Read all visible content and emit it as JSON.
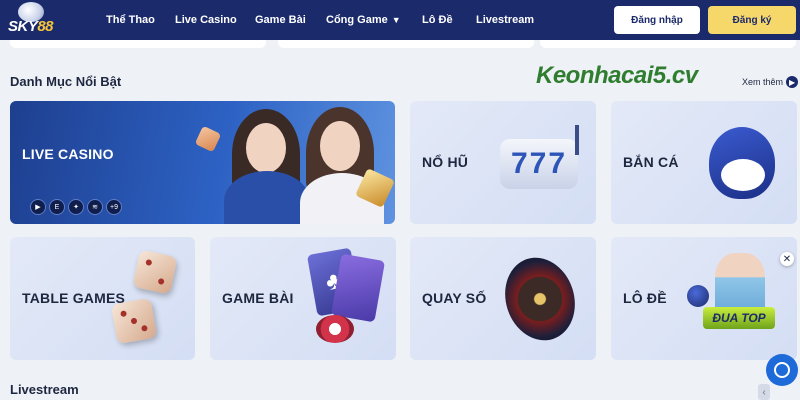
{
  "brand": {
    "logo_text_1": "SKY",
    "logo_text_2": "88"
  },
  "nav": {
    "items": [
      {
        "label": "Thể Thao"
      },
      {
        "label": "Live Casino"
      },
      {
        "label": "Game Bài"
      },
      {
        "label": "Cổng Game",
        "has_dropdown": true
      },
      {
        "label": "Lô Đề"
      },
      {
        "label": "Livestream"
      }
    ],
    "login_label": "Đăng nhập",
    "register_label": "Đăng ký"
  },
  "featured": {
    "title": "Danh Mục Nổi Bật",
    "see_more": "Xem thêm",
    "watermark": "Keonhacai5.cv",
    "cards": [
      {
        "label": "LIVE CASINO"
      },
      {
        "label": "NỔ HŨ"
      },
      {
        "label": "BẮN CÁ"
      },
      {
        "label": "TABLE GAMES"
      },
      {
        "label": "GAME BÀI"
      },
      {
        "label": "QUAY SỐ"
      },
      {
        "label": "LÔ ĐỀ"
      }
    ],
    "providers_more": "+9",
    "slot_digits": "777",
    "banner_text": "ĐUA TOP"
  },
  "livestream": {
    "title": "Livestream"
  },
  "colors": {
    "header": "#1b2a6b",
    "accent": "#f6d76a",
    "chat": "#1e6ad8"
  }
}
